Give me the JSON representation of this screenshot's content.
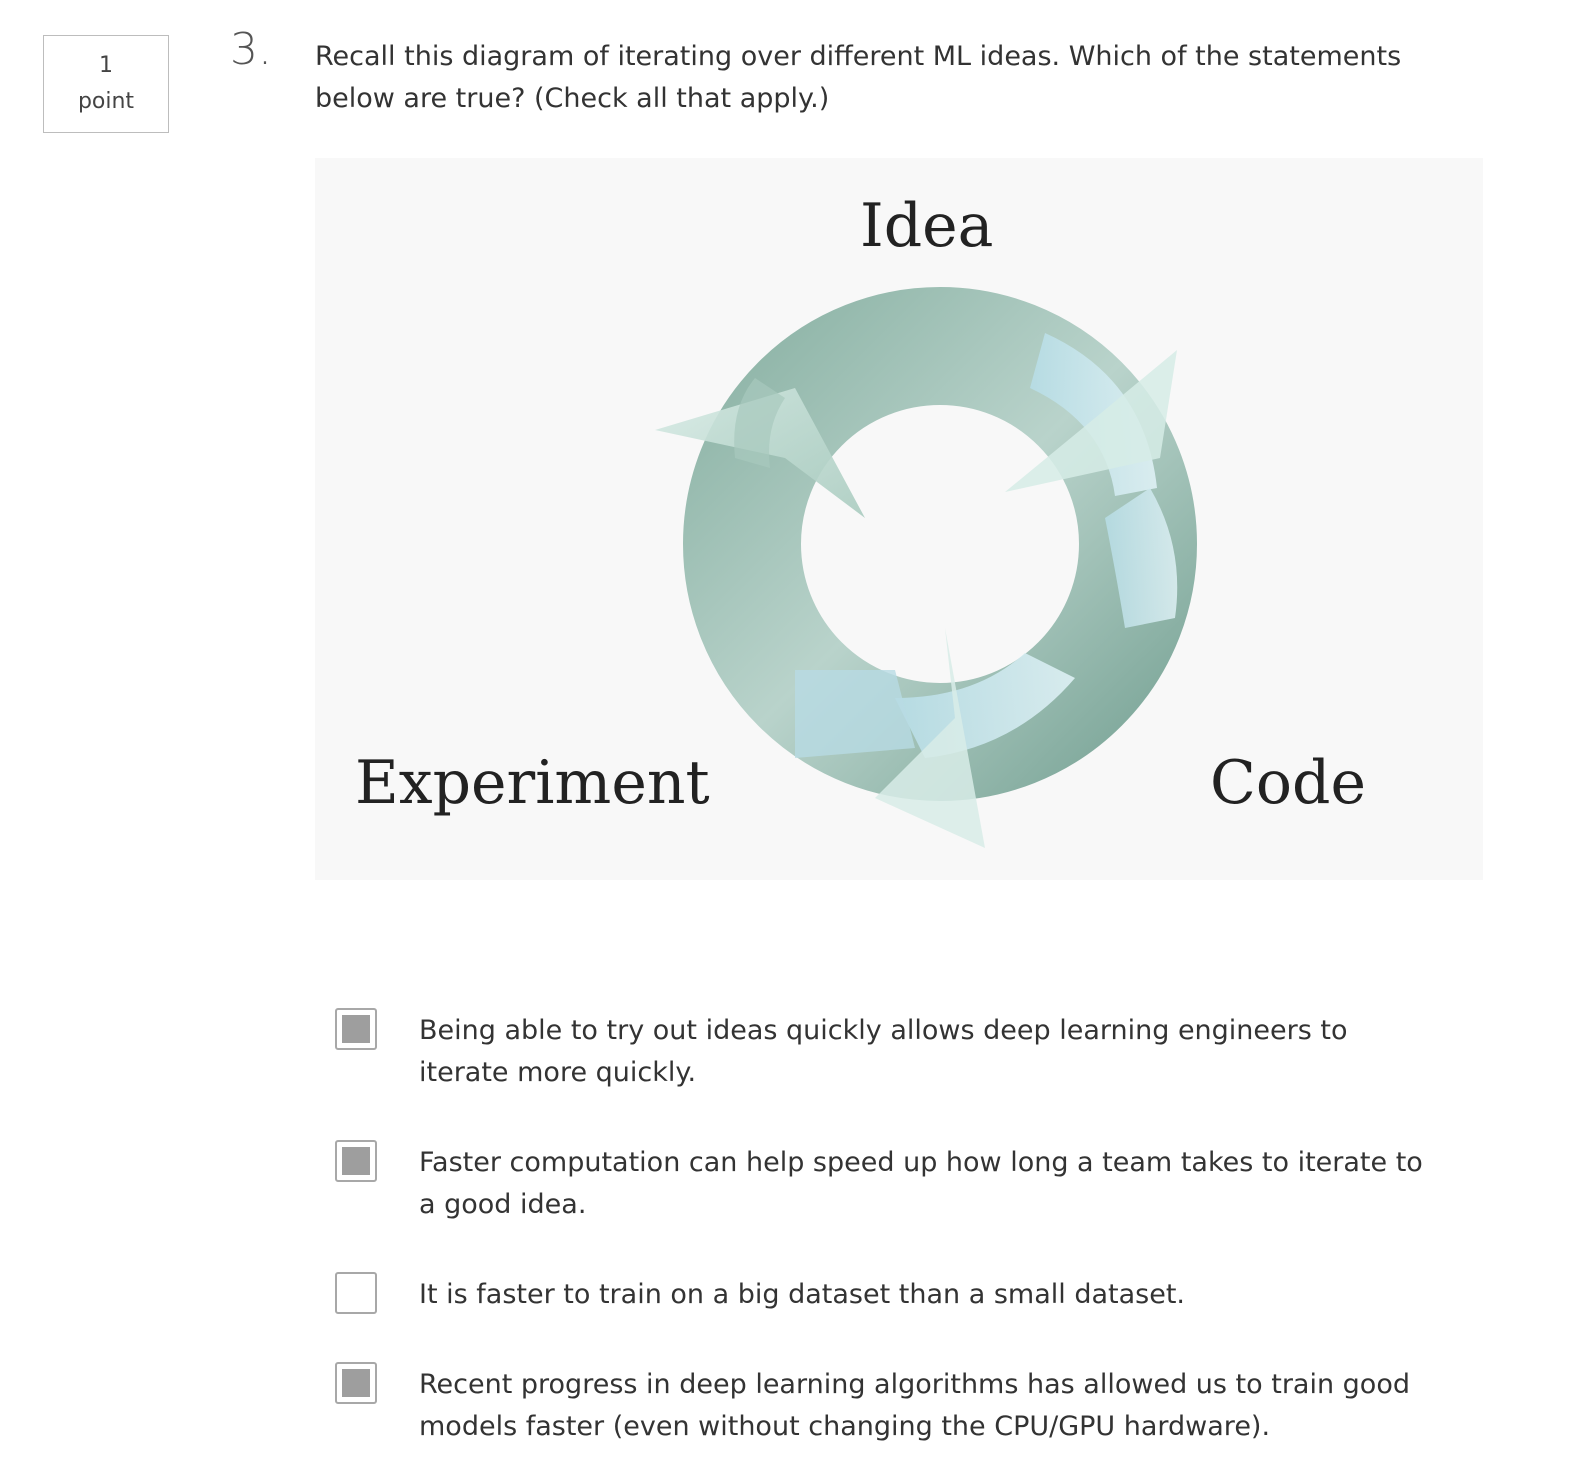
{
  "points": {
    "value": "1",
    "unit": "point"
  },
  "question": {
    "number": "3.",
    "text": "Recall this diagram of iterating over different ML ideas. Which of the statements below are true? (Check all that apply.)"
  },
  "diagram": {
    "labels": {
      "top": "Idea",
      "left": "Experiment",
      "right": "Code"
    }
  },
  "options": [
    {
      "text": "Being able to try out ideas quickly allows deep learning engineers to iterate more quickly.",
      "checked": true
    },
    {
      "text": "Faster computation can help speed up how long a team takes to iterate to a good idea.",
      "checked": true
    },
    {
      "text": "It is faster to train on a big dataset than a small dataset.",
      "checked": false
    },
    {
      "text": "Recent progress in deep learning algorithms has allowed us to train good models faster (even without changing the CPU/GPU hardware).",
      "checked": true
    }
  ],
  "colors": {
    "ring_dark": "#7fa89b",
    "ring_light": "#cfe8ef",
    "checked_fill": "#9e9e9e"
  }
}
